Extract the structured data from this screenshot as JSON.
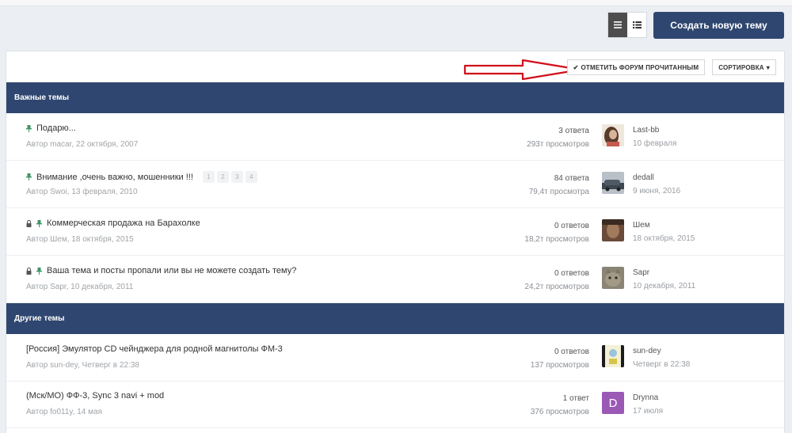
{
  "toolbar": {
    "create_label": "Создать новую тему",
    "mark_read_label": "ОТМЕТИТЬ ФОРУМ ПРОЧИТАННЫМ",
    "sort_label": "СОРТИРОВКА"
  },
  "sections": {
    "pinned_title": "Важные темы",
    "other_title": "Другие темы"
  },
  "topics": [
    {
      "title": "Подарю...",
      "meta": "Автор macar, 22 октября, 2007",
      "replies": "3 ответа",
      "views": "293т просмотров",
      "last_user": "Last-bb",
      "last_date": "10 февраля",
      "pinned": true,
      "locked": false
    },
    {
      "title": "Внимание ,очень важно, мошенники !!!",
      "meta": "Автор Swoi, 13 февраля, 2010",
      "replies": "84 ответа",
      "views": "79,4т просмотра",
      "last_user": "dedall",
      "last_date": "9 июня, 2016",
      "pinned": true,
      "locked": false,
      "pages": [
        "1",
        "2",
        "3",
        "4"
      ]
    },
    {
      "title": "Коммерческая продажа на Барахолке",
      "meta": "Автор Шем, 18 октября, 2015",
      "replies": "0 ответов",
      "views": "18,2т просмотров",
      "last_user": "Шем",
      "last_date": "18 октября, 2015",
      "pinned": true,
      "locked": true
    },
    {
      "title": "Ваша тема и посты пропали или вы не можете создать тему?",
      "meta": "Автор Sapr, 10 декабря, 2011",
      "replies": "0 ответов",
      "views": "24,2т просмотров",
      "last_user": "Sapr",
      "last_date": "10 декабря, 2011",
      "pinned": true,
      "locked": true
    },
    {
      "title": "[Россия] Эмулятор CD чейнджера для родной магнитолы ФМ-3",
      "meta": "Автор sun-dey, Четверг в 22:38",
      "replies": "0 ответов",
      "views": "137 просмотров",
      "last_user": "sun-dey",
      "last_date": "Четверг в 22:38",
      "pinned": false,
      "locked": false
    },
    {
      "title": "(Мск/МО) ФФ-3, Sync 3 navi + mod",
      "meta": "Автор fo011y, 14 мая",
      "replies": "1 ответ",
      "views": "376 просмотров",
      "last_user": "Drynna",
      "last_date": "17 июля",
      "pinned": false,
      "locked": false,
      "avatar_letter": "D"
    }
  ],
  "colors": {
    "brand": "#2f4770",
    "pin": "#3d9463",
    "arrow": "#d0101a",
    "avatar_letter_bg": "#9b59b6"
  },
  "icons": {
    "view_list": "list-view-icon",
    "view_detail": "detail-view-icon",
    "pin": "pin-icon",
    "lock": "lock-icon",
    "check": "check-icon",
    "caret": "caret-down-icon"
  }
}
